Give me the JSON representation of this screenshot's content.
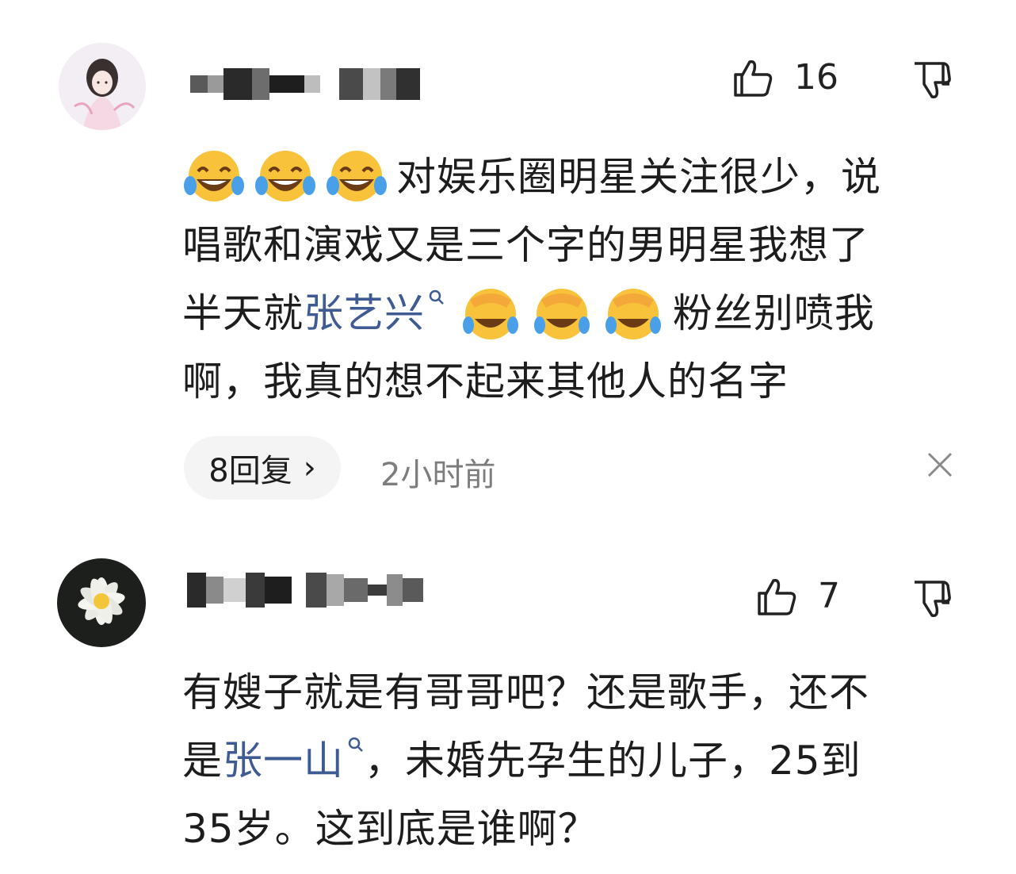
{
  "comments": [
    {
      "avatar": "anime-girl-avatar",
      "likes": "16",
      "line1": "对娱乐圈明星关注很少，说",
      "line2": "唱歌和演戏又是三个字的男明星我想了",
      "line3_a": "半天就",
      "line3_link": "张艺兴",
      "line3_b": "粉丝别喷我",
      "line4": "啊，我真的想不起来其他人的名字",
      "emoji_row1": [
        "tears-of-joy-emoji",
        "tears-of-joy-emoji",
        "tears-of-joy-emoji"
      ],
      "emoji_row3": [
        "facepalm-cry-emoji",
        "facepalm-cry-emoji",
        "facepalm-cry-emoji"
      ],
      "replies_label": "8回复",
      "chevron": "›",
      "time": "2小时前"
    },
    {
      "avatar": "white-lotus-avatar",
      "likes": "7",
      "line1": "有嫂子就是有哥哥吧？还是歌手，还不",
      "line2_a": "是",
      "line2_link": "张一山",
      "line2_b": "，未婚先孕生的儿子，25到",
      "line3": "35岁。这到底是谁啊？"
    }
  ],
  "icons": {
    "like": "thumbs-up-icon",
    "dislike": "thumbs-down-icon",
    "search": "search-icon",
    "close": "close-icon"
  },
  "colors": {
    "link": "#3f5b93",
    "text": "#1d1d1d",
    "muted": "#7d7d7d",
    "pill": "#f4f4f4"
  }
}
